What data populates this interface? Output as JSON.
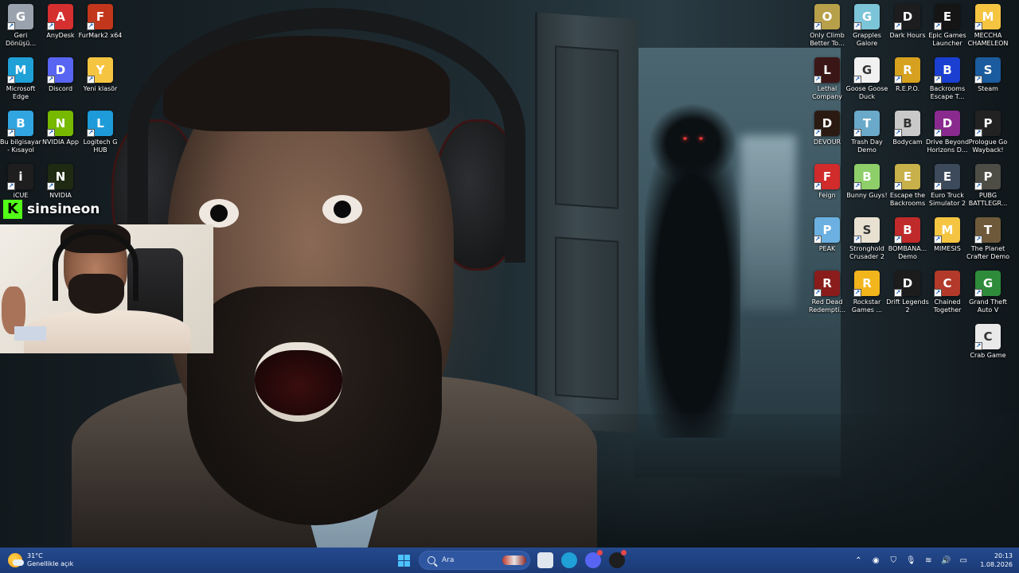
{
  "desktop": {
    "left_icons": [
      {
        "label": "Geri Dönüşü...",
        "icon": "recycle-bin-icon",
        "color": "#9aa3ad"
      },
      {
        "label": "AnyDesk",
        "icon": "anydesk-icon",
        "color": "#d62f2f"
      },
      {
        "label": "FurMark2 x64",
        "icon": "furmark-icon",
        "color": "#c2371b"
      },
      {
        "label": "Microsoft Edge",
        "icon": "edge-icon",
        "color": "#1fa0d6"
      },
      {
        "label": "Discord",
        "icon": "discord-icon",
        "color": "#5865f2"
      },
      {
        "label": "Yeni klasör",
        "icon": "folder-icon",
        "color": "#f5c542"
      },
      {
        "label": "Bu bilgisayar - Kısayol",
        "icon": "computer-icon",
        "color": "#31a5e0"
      },
      {
        "label": "NVIDIA App",
        "icon": "nvidia-icon",
        "color": "#76b900"
      },
      {
        "label": "Logitech G HUB",
        "icon": "logitech-icon",
        "color": "#1d9bd8"
      },
      {
        "label": "iCUE",
        "icon": "icue-icon",
        "color": "#1e1e1e"
      },
      {
        "label": "NVIDIA",
        "icon": "nvidia-icon",
        "color": "#1e2a12"
      }
    ],
    "right_icons": [
      {
        "label": "Only Climb Better To...",
        "icon": "only-climb-icon",
        "color": "#b8a04a"
      },
      {
        "label": "Grapples Galore",
        "icon": "grapples-icon",
        "color": "#7cc4d8"
      },
      {
        "label": "Dark Hours",
        "icon": "dark-hours-icon",
        "color": "#1d1d1f"
      },
      {
        "label": "Epic Games Launcher",
        "icon": "epic-games-icon",
        "color": "#151515"
      },
      {
        "label": "MECCHA CHAMELEON",
        "icon": "folder-icon",
        "color": "#f5c542"
      },
      {
        "label": "Lethal Company",
        "icon": "lethal-company-icon",
        "color": "#3b1616"
      },
      {
        "label": "Goose Goose Duck",
        "icon": "goose-icon",
        "color": "#f1f1f1"
      },
      {
        "label": "R.E.P.O.",
        "icon": "repo-icon",
        "color": "#d6a11f"
      },
      {
        "label": "Backrooms Escape T...",
        "icon": "backrooms-icon",
        "color": "#1b3fd1"
      },
      {
        "label": "Steam",
        "icon": "steam-icon",
        "color": "#1b5b9e"
      },
      {
        "label": "DEVOUR",
        "icon": "devour-icon",
        "color": "#2a1a12"
      },
      {
        "label": "Trash Day Demo",
        "icon": "trash-day-icon",
        "color": "#6aa9c9"
      },
      {
        "label": "Bodycam",
        "icon": "bodycam-icon",
        "color": "#c9c9c9"
      },
      {
        "label": "Drive Beyond Horizons D...",
        "icon": "drive-beyond-icon",
        "color": "#8a2a8f"
      },
      {
        "label": "Prologue Go Wayback!",
        "icon": "prologue-icon",
        "color": "#222222"
      },
      {
        "label": "Feign",
        "icon": "feign-icon",
        "color": "#d12b2b"
      },
      {
        "label": "Bunny Guys!",
        "icon": "bunny-icon",
        "color": "#8fcf6a"
      },
      {
        "label": "Escape the Backrooms",
        "icon": "escape-backrooms-icon",
        "color": "#c8b04a"
      },
      {
        "label": "Euro Truck Simulator 2",
        "icon": "truck-icon",
        "color": "#3c4a5c"
      },
      {
        "label": "PUBG BATTLEGR...",
        "icon": "pubg-icon",
        "color": "#4d4d45"
      },
      {
        "label": "PEAK",
        "icon": "peak-icon",
        "color": "#6bb0e0"
      },
      {
        "label": "Stronghold Crusader 2",
        "icon": "stronghold-icon",
        "color": "#e8e1d2"
      },
      {
        "label": "BOMBANA... Demo",
        "icon": "bombana-icon",
        "color": "#c02a2a"
      },
      {
        "label": "MIMESIS",
        "icon": "folder-icon",
        "color": "#f5c542"
      },
      {
        "label": "The Planet Crafter Demo",
        "icon": "planet-crafter-icon",
        "color": "#6e5a3a"
      },
      {
        "label": "Red Dead Redempti...",
        "icon": "red-dead-icon",
        "color": "#8b1c1c"
      },
      {
        "label": "Rockstar Games ...",
        "icon": "rockstar-icon",
        "color": "#f2b51c"
      },
      {
        "label": "Drift Legends 2",
        "icon": "drift-legends-icon",
        "color": "#1c1c1c"
      },
      {
        "label": "Chained Together",
        "icon": "chained-icon",
        "color": "#b33a2a"
      },
      {
        "label": "Grand Theft Auto V",
        "icon": "gta-icon",
        "color": "#2e8b3a"
      },
      {
        "label": "Crab Game",
        "icon": "crab-game-icon",
        "color": "#e9e9e9"
      }
    ]
  },
  "stream_overlay": {
    "kick_logo": "K",
    "channel_name": "sinsineon",
    "kick_color": "#53fc18"
  },
  "taskbar": {
    "weather_temp": "31°C",
    "weather_condition": "Genellikle açık",
    "search_placeholder": "Ara",
    "time": "20:13",
    "date": "1.08.2026",
    "apps": [
      {
        "name": "file-explorer-icon",
        "color": "#e0e6ee"
      },
      {
        "name": "edge-icon",
        "color": "#1fa0d6"
      },
      {
        "name": "discord-icon",
        "color": "#5865f2"
      },
      {
        "name": "obs-icon",
        "color": "#1e1e1e"
      }
    ],
    "tray": [
      {
        "name": "chevron-up-icon",
        "glyph": "⌃"
      },
      {
        "name": "nvidia-tray-icon",
        "glyph": "◉"
      },
      {
        "name": "shield-icon",
        "glyph": "⛉"
      },
      {
        "name": "microphone-icon",
        "glyph": "🎙"
      },
      {
        "name": "wifi-icon",
        "glyph": "≋"
      },
      {
        "name": "volume-icon",
        "glyph": "🔊"
      },
      {
        "name": "battery-icon",
        "glyph": "▭"
      }
    ]
  }
}
